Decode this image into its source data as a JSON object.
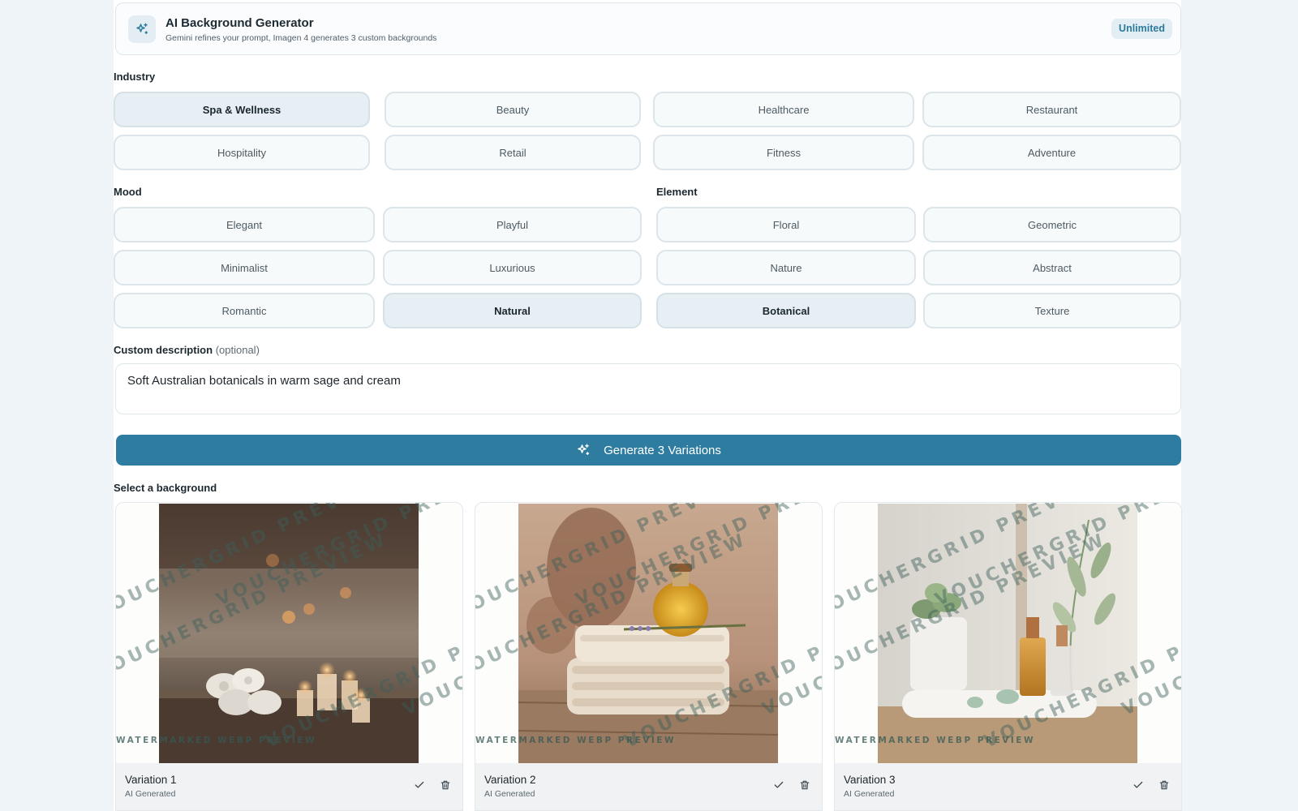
{
  "header": {
    "title": "AI Background Generator",
    "subtitle": "Gemini refines your prompt, Imagen 4 generates 3 custom backgrounds",
    "badge": "Unlimited",
    "icon": "sparkles-icon"
  },
  "industry": {
    "label": "Industry",
    "options": [
      "Spa & Wellness",
      "Beauty",
      "Healthcare",
      "Restaurant",
      "Hospitality",
      "Retail",
      "Fitness",
      "Adventure"
    ],
    "selected": "Spa & Wellness"
  },
  "mood": {
    "label": "Mood",
    "options": [
      "Elegant",
      "Playful",
      "Minimalist",
      "Luxurious",
      "Romantic",
      "Natural"
    ],
    "selected": "Natural"
  },
  "element": {
    "label": "Element",
    "options": [
      "Floral",
      "Geometric",
      "Nature",
      "Abstract",
      "Botanical",
      "Texture"
    ],
    "selected": "Botanical"
  },
  "custom": {
    "label": "Custom description",
    "optional": "(optional)",
    "value": "Soft Australian botanicals in warm sage and cream"
  },
  "generate_button": "Generate 3 Variations",
  "results": {
    "label": "Select a background",
    "watermark_text": "VOUCHERGRID PREVIEW",
    "watermark_line": "WATERMARKED WEBP PREVIEW",
    "cards": [
      {
        "title": "Variation 1",
        "subtitle": "AI Generated",
        "scene": "candles and rolled towels"
      },
      {
        "title": "Variation 2",
        "subtitle": "AI Generated",
        "scene": "folded towels and oil bottle"
      },
      {
        "title": "Variation 3",
        "subtitle": "AI Generated",
        "scene": "succulent and serum bottles"
      }
    ]
  },
  "colors": {
    "accent": "#2e7da1",
    "page_bg": "#eef4f7",
    "chip_border": "#dbe5ea",
    "chip_selected_bg": "#e7eff4"
  }
}
